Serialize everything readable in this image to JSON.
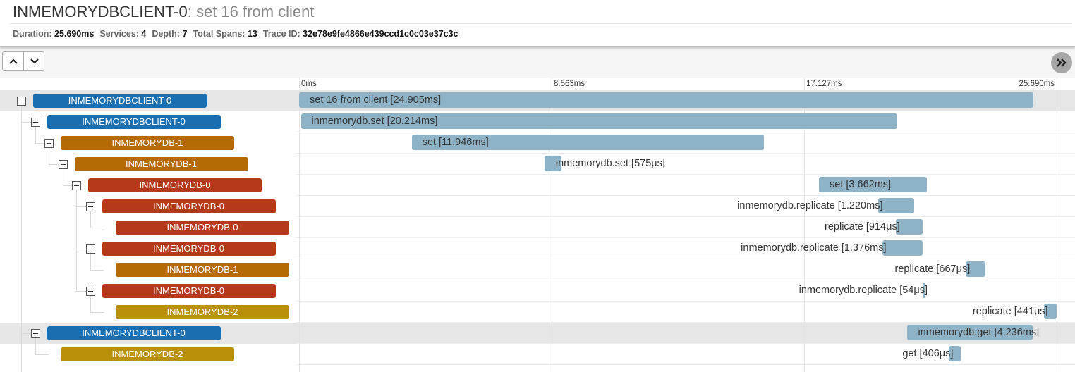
{
  "title": {
    "service": "INMEMORYDBCLIENT-0",
    "operation": ": set 16 from client"
  },
  "summary": [
    {
      "label": "Duration:",
      "value": "25.690ms"
    },
    {
      "label": "Services:",
      "value": "4"
    },
    {
      "label": "Depth:",
      "value": "7"
    },
    {
      "label": "Total Spans:",
      "value": "13"
    },
    {
      "label": "Trace ID:",
      "value": "32e78e9fe4866e439ccd1c0c03e37c3c"
    }
  ],
  "toolbar": {
    "up_icon": "chevron-up-icon",
    "down_icon": "chevron-down-icon",
    "expand_icon": "double-chevron-right-icon"
  },
  "timeline": {
    "total_ms": 25.69,
    "ticks": [
      {
        "label": "0ms",
        "ms": 0
      },
      {
        "label": "8.563ms",
        "ms": 8.563
      },
      {
        "label": "17.127ms",
        "ms": 17.127
      },
      {
        "label": "25.690ms",
        "ms": 25.69
      }
    ]
  },
  "colors": {
    "INMEMORYDBCLIENT-0": "#1b6fb0",
    "INMEMORYDB-0": "#b43a1b",
    "INMEMORYDB-1": "#b56a06",
    "INMEMORYDB-2": "#b8900a",
    "span_bar": "#8fb3c6",
    "row_highlight": "#e6e6e6"
  },
  "spans": [
    {
      "service": "INMEMORYDBCLIENT-0",
      "depth": 0,
      "collapsible": true,
      "highlight": true,
      "label": "set 16 from client [24.905ms]",
      "start_ms": 0.0,
      "dur_ms": 24.905,
      "label_side": "inside"
    },
    {
      "service": "INMEMORYDBCLIENT-0",
      "depth": 1,
      "collapsible": true,
      "highlight": false,
      "label": "inmemorydb.set [20.214ms]",
      "start_ms": 0.06,
      "dur_ms": 20.214,
      "label_side": "inside"
    },
    {
      "service": "INMEMORYDB-1",
      "depth": 2,
      "collapsible": true,
      "highlight": false,
      "label": "set [11.946ms]",
      "start_ms": 3.82,
      "dur_ms": 11.946,
      "label_side": "inside"
    },
    {
      "service": "INMEMORYDB-1",
      "depth": 3,
      "collapsible": true,
      "highlight": false,
      "label": "inmemorydb.set [575μs]",
      "start_ms": 8.32,
      "dur_ms": 0.575,
      "label_side": "right"
    },
    {
      "service": "INMEMORYDB-0",
      "depth": 4,
      "collapsible": true,
      "highlight": false,
      "label": "set [3.662ms]",
      "start_ms": 17.63,
      "dur_ms": 3.662,
      "label_side": "inside"
    },
    {
      "service": "INMEMORYDB-0",
      "depth": 5,
      "collapsible": true,
      "highlight": false,
      "label": "inmemorydb.replicate [1.220ms]",
      "start_ms": 19.65,
      "dur_ms": 1.22,
      "label_side": "left"
    },
    {
      "service": "INMEMORYDB-0",
      "depth": 6,
      "collapsible": false,
      "highlight": false,
      "label": "replicate [914μs]",
      "start_ms": 20.23,
      "dur_ms": 0.914,
      "label_side": "left"
    },
    {
      "service": "INMEMORYDB-0",
      "depth": 5,
      "collapsible": true,
      "highlight": false,
      "label": "inmemorydb.replicate [1.376ms]",
      "start_ms": 19.77,
      "dur_ms": 1.376,
      "label_side": "left"
    },
    {
      "service": "INMEMORYDB-1",
      "depth": 6,
      "collapsible": false,
      "highlight": false,
      "label": "replicate [667μs]",
      "start_ms": 22.61,
      "dur_ms": 0.667,
      "label_side": "left"
    },
    {
      "service": "INMEMORYDB-0",
      "depth": 5,
      "collapsible": true,
      "highlight": false,
      "label": "inmemorydb.replicate [54μs]",
      "start_ms": 21.17,
      "dur_ms": 0.054,
      "label_side": "left"
    },
    {
      "service": "INMEMORYDB-2",
      "depth": 6,
      "collapsible": false,
      "highlight": false,
      "label": "replicate [441μs]",
      "start_ms": 25.25,
      "dur_ms": 0.441,
      "label_side": "left"
    },
    {
      "service": "INMEMORYDBCLIENT-0",
      "depth": 1,
      "collapsible": true,
      "highlight": true,
      "label": "inmemorydb.get [4.236ms]",
      "start_ms": 20.63,
      "dur_ms": 4.236,
      "label_side": "inside"
    },
    {
      "service": "INMEMORYDB-2",
      "depth": 2,
      "collapsible": false,
      "highlight": false,
      "label": "get [406μs]",
      "start_ms": 22.04,
      "dur_ms": 0.406,
      "label_side": "left"
    }
  ]
}
